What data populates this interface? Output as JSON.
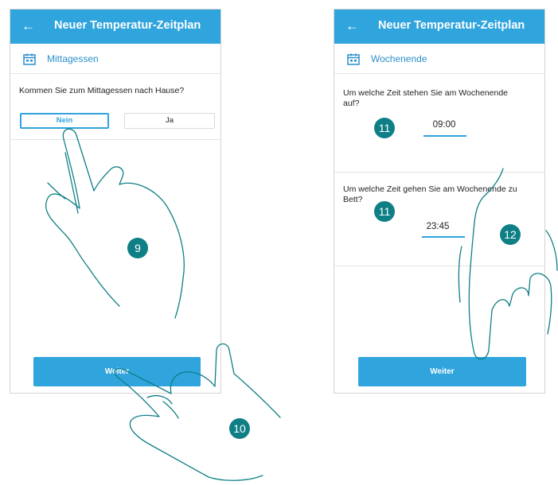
{
  "left_screen": {
    "back_icon": "back-arrow-icon",
    "title": "Neuer Temperatur-Zeitplan",
    "section_icon": "calendar-icon",
    "section_label": "Mittagessen",
    "question": "Kommen Sie zum Mittagessen nach Hause?",
    "options": [
      {
        "label": "Nein",
        "selected": true
      },
      {
        "label": "Ja",
        "selected": false
      }
    ],
    "next_label": "Weiter"
  },
  "right_screen": {
    "back_icon": "back-arrow-icon",
    "title": "Neuer Temperatur-Zeitplan",
    "section_icon": "calendar-icon",
    "section_label": "Wochenende",
    "wake_question": "Um welche Zeit stehen Sie am Wochenende auf?",
    "wake_time": "09:00",
    "bed_question": "Um welche Zeit gehen Sie am Wochenende zu Bett?",
    "bed_time": "23:45",
    "next_label": "Weiter"
  },
  "callouts": [
    "9",
    "10",
    "11",
    "11",
    "12"
  ],
  "colors": {
    "accent": "#2fa4dd",
    "callout": "#0f7f86",
    "hand_outline": "#0f7f86"
  }
}
